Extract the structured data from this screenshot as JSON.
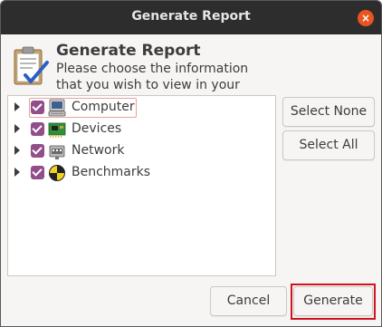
{
  "window": {
    "title": "Generate Report",
    "close_label": "×"
  },
  "header": {
    "title": "Generate Report",
    "description": "Please choose the information that you wish to view in your report:"
  },
  "tree": {
    "items": [
      {
        "label": "Computer",
        "checked": true,
        "icon": "computer-icon"
      },
      {
        "label": "Devices",
        "checked": true,
        "icon": "devices-icon"
      },
      {
        "label": "Network",
        "checked": true,
        "icon": "network-icon"
      },
      {
        "label": "Benchmarks",
        "checked": true,
        "icon": "benchmarks-icon"
      }
    ]
  },
  "buttons": {
    "select_none": "Select None",
    "select_all": "Select All",
    "cancel": "Cancel",
    "generate": "Generate"
  },
  "colors": {
    "titlebar": "#2d2d2d",
    "close": "#e95420",
    "checkbox": "#924d8b",
    "highlight": "#d0141f"
  }
}
